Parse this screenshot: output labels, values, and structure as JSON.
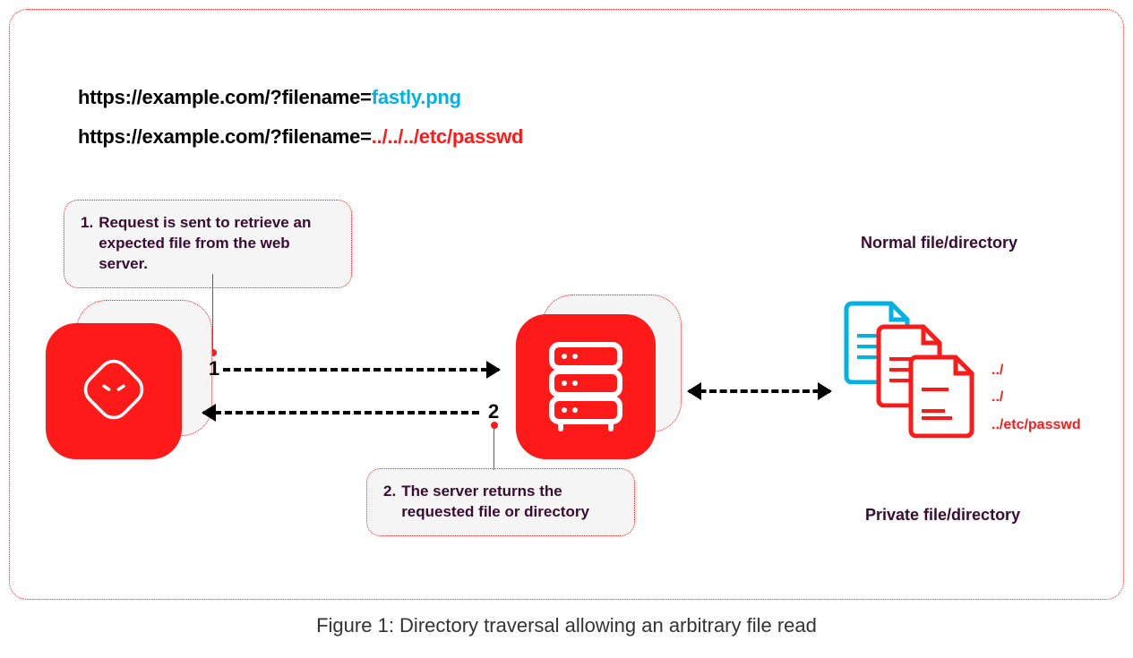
{
  "urls": {
    "prefix1": "https://example.com/?filename=",
    "param1": "fastly.png",
    "prefix2": "https://example.com/?filename=",
    "param2": "../../../etc/passwd"
  },
  "callouts": {
    "c1_num": "1.",
    "c1_text": "Request is sent to retrieve an expected file from the web server.",
    "c2_num": "2.",
    "c2_text": "The server returns the requested file or directory"
  },
  "steps": {
    "s1": "1",
    "s2": "2"
  },
  "labels": {
    "normal": "Normal file/directory",
    "private": "Private file/directory"
  },
  "file_paths": {
    "p1": "../",
    "p2": "../",
    "p3": "../etc/passwd"
  },
  "caption": "Figure 1: Directory traversal allowing an arbitrary file read"
}
